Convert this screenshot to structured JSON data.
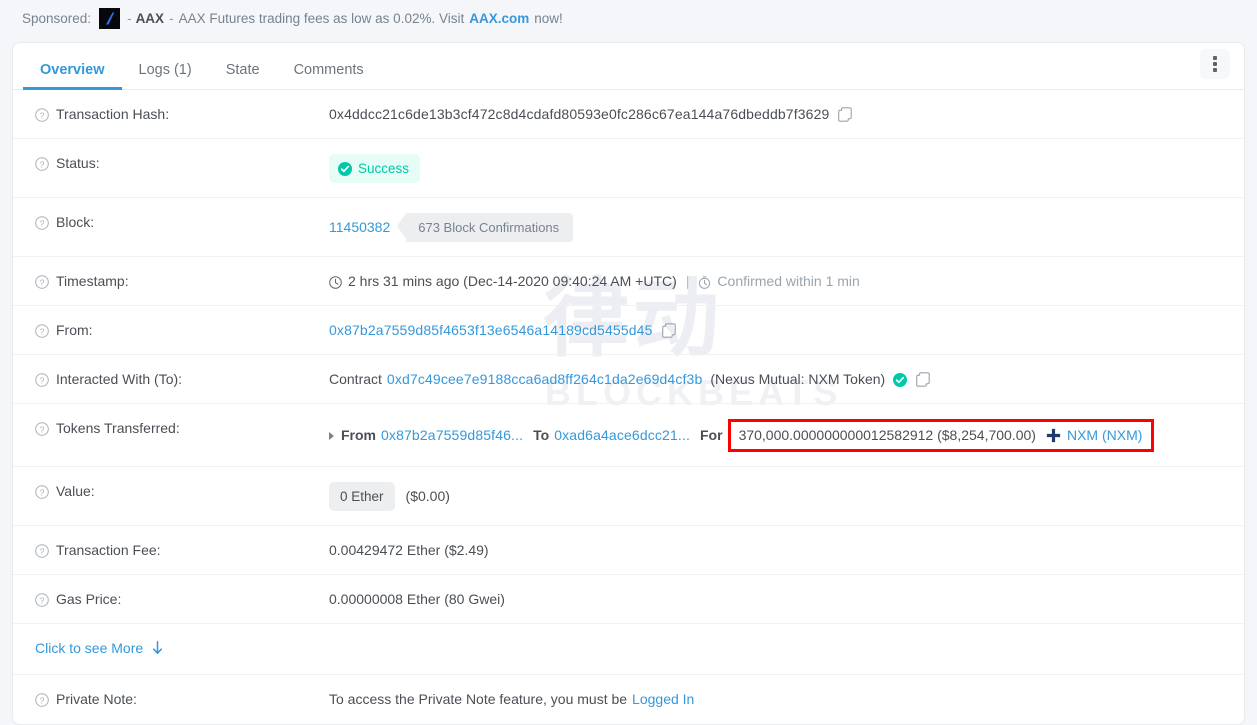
{
  "sponsor": {
    "label": "Sponsored:",
    "logo_icon": "aax-logo-icon",
    "dash1": "-",
    "brand": "AAX",
    "dash2": "-",
    "text": "AAX Futures trading fees as low as 0.02%. Visit",
    "link": "AAX.com",
    "end": "now!"
  },
  "tabs": [
    {
      "label": "Overview",
      "active": true
    },
    {
      "label": "Logs (1)",
      "active": false
    },
    {
      "label": "State",
      "active": false
    },
    {
      "label": "Comments",
      "active": false
    }
  ],
  "menu_icon": "kebab-menu-icon",
  "watermark": {
    "cn": "律动",
    "en": "BLOCKBEATS"
  },
  "rows": {
    "transaction_hash": {
      "label": "Transaction Hash:",
      "value": "0x4ddcc21c6de13b3cf472c8d4cdafd80593e0fc286c67ea144a76dbeddb7f3629",
      "copy_icon": "copy-icon"
    },
    "status": {
      "label": "Status:",
      "value": "Success",
      "icon": "check-circle-icon",
      "color": "#00c9a7",
      "bg": "#e6fcf7"
    },
    "block": {
      "label": "Block:",
      "number": "11450382",
      "confirmations": "673 Block Confirmations"
    },
    "timestamp": {
      "label": "Timestamp:",
      "clock_icon": "clock-icon",
      "ago": "2 hrs 31 mins ago (Dec-14-2020 09:40:24 AM +UTC)",
      "separator": "|",
      "confirmed_icon": "stopwatch-icon",
      "confirmed": "Confirmed within 1 min"
    },
    "from": {
      "label": "From:",
      "address": "0x87b2a7559d85f4653f13e6546a14189cd5455d45",
      "copy_icon": "copy-icon"
    },
    "interacted_with": {
      "label": "Interacted With (To):",
      "prefix": "Contract",
      "address": "0xd7c49cee7e9188cca6ad8ff264c1da2e69d4cf3b",
      "name": "(Nexus Mutual: NXM Token)",
      "verified_icon": "verified-check-icon",
      "copy_icon": "copy-icon"
    },
    "tokens_transferred": {
      "label": "Tokens Transferred:",
      "expand_icon": "expand-triangle-icon",
      "from_label": "From",
      "from_address": "0x87b2a7559d85f46...",
      "to_label": "To",
      "to_address": "0xad6a4ace6dcc21...",
      "for_label": "For",
      "amount": "370,000.000000000012582912 ($8,254,700.00)",
      "token_icon": "nxm-token-icon",
      "token": "NXM (NXM)",
      "highlight_color": "#ff0000"
    },
    "value": {
      "label": "Value:",
      "amount": "0 Ether",
      "usd": "($0.00)"
    },
    "transaction_fee": {
      "label": "Transaction Fee:",
      "value": "0.00429472 Ether ($2.49)"
    },
    "gas_price": {
      "label": "Gas Price:",
      "value": "0.00000008 Ether (80 Gwei)"
    },
    "click_more": {
      "label": "Click to see More",
      "icon": "arrow-down-icon"
    },
    "private_note": {
      "label": "Private Note:",
      "text": "To access the Private Note feature, you must be",
      "link": "Logged In"
    }
  }
}
